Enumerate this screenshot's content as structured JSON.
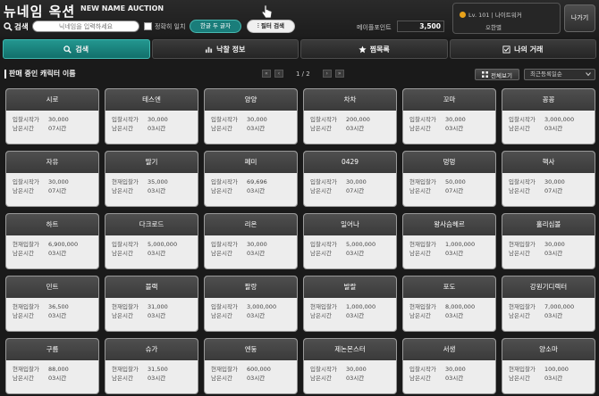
{
  "header": {
    "title": "뉴네임 옥션",
    "subtitle": "NEW NAME AUCTION",
    "search_label": "검색",
    "search_placeholder": "닉네임을 입력하세요",
    "exact_match_label": "정확히 일치",
    "search_mode_button": "한글 두 글자",
    "filter_button": "필터 검색",
    "points_label": "메이플포인트",
    "points_value": "3,500",
    "profile_level": "Lv. 101 | 나이트워커",
    "profile_name": "오한별",
    "exit_button": "나가기"
  },
  "tabs": [
    {
      "label": "검색",
      "icon": "search-icon",
      "active": true
    },
    {
      "label": "낙찰 정보",
      "icon": "bar-chart-icon",
      "active": false
    },
    {
      "label": "찜목록",
      "icon": "star-icon",
      "active": false
    },
    {
      "label": "나의 거래",
      "icon": "checkbox-icon",
      "active": false
    }
  ],
  "list": {
    "title": "판매 중인 캐릭터 이름",
    "page_text": "1 / 2",
    "view_all": "전체보기",
    "sort_selected": "최근등록일순"
  },
  "cards": [
    {
      "name": "시로",
      "price_label": "입찰시작가",
      "price": "30,000",
      "time_label": "남은시간",
      "time": "07시간"
    },
    {
      "name": "테스엔",
      "price_label": "입찰시작가",
      "price": "30,000",
      "time_label": "남은시간",
      "time": "03시간"
    },
    {
      "name": "양양",
      "price_label": "입찰시작가",
      "price": "30,000",
      "time_label": "남은시간",
      "time": "03시간"
    },
    {
      "name": "차차",
      "price_label": "입찰시작가",
      "price": "200,000",
      "time_label": "남은시간",
      "time": "03시간"
    },
    {
      "name": "꼬마",
      "price_label": "입찰시작가",
      "price": "30,000",
      "time_label": "남은시간",
      "time": "03시간"
    },
    {
      "name": "꽁꽁",
      "price_label": "입찰시작가",
      "price": "3,000,000",
      "time_label": "남은시간",
      "time": "03시간"
    },
    {
      "name": "자유",
      "price_label": "입찰시작가",
      "price": "30,000",
      "time_label": "남은시간",
      "time": "07시간"
    },
    {
      "name": "딸기",
      "price_label": "현재입찰가",
      "price": "35,000",
      "time_label": "남은시간",
      "time": "03시간"
    },
    {
      "name": "페미",
      "price_label": "입찰시작가",
      "price": "69,696",
      "time_label": "남은시간",
      "time": "03시간"
    },
    {
      "name": "0429",
      "price_label": "입찰시작가",
      "price": "30,000",
      "time_label": "남은시간",
      "time": "07시간"
    },
    {
      "name": "멍멍",
      "price_label": "현재입찰가",
      "price": "50,000",
      "time_label": "남은시간",
      "time": "07시간"
    },
    {
      "name": "핵사",
      "price_label": "입찰시작가",
      "price": "30,000",
      "time_label": "남은시간",
      "time": "07시간"
    },
    {
      "name": "하트",
      "price_label": "현재입찰가",
      "price": "6,900,000",
      "time_label": "남은시간",
      "time": "03시간"
    },
    {
      "name": "다크로드",
      "price_label": "입찰시작가",
      "price": "5,000,000",
      "time_label": "남은시간",
      "time": "03시간"
    },
    {
      "name": "리온",
      "price_label": "입찰시작가",
      "price": "30,000",
      "time_label": "남은시간",
      "time": "03시간"
    },
    {
      "name": "일어나",
      "price_label": "입찰시작가",
      "price": "5,000,000",
      "time_label": "남은시간",
      "time": "03시간"
    },
    {
      "name": "왕사슴헤르",
      "price_label": "현재입찰가",
      "price": "1,000,000",
      "time_label": "남은시간",
      "time": "03시간"
    },
    {
      "name": "홀리심볼",
      "price_label": "현재입찰가",
      "price": "30,000",
      "time_label": "남은시간",
      "time": "03시간"
    },
    {
      "name": "민트",
      "price_label": "현재입찰가",
      "price": "36,500",
      "time_label": "남은시간",
      "time": "03시간"
    },
    {
      "name": "블랙",
      "price_label": "현재입찰가",
      "price": "31,000",
      "time_label": "남은시간",
      "time": "03시간"
    },
    {
      "name": "팔랑",
      "price_label": "입찰시작가",
      "price": "3,000,000",
      "time_label": "남은시간",
      "time": "03시간"
    },
    {
      "name": "발랄",
      "price_label": "현재입찰가",
      "price": "1,000,000",
      "time_label": "남은시간",
      "time": "03시간"
    },
    {
      "name": "포도",
      "price_label": "현재입찰가",
      "price": "8,000,000",
      "time_label": "남은시간",
      "time": "03시간"
    },
    {
      "name": "강원기디렉터",
      "price_label": "현재입찰가",
      "price": "7,000,000",
      "time_label": "남은시간",
      "time": "03시간"
    },
    {
      "name": "구름",
      "price_label": "현재입찰가",
      "price": "88,000",
      "time_label": "남은시간",
      "time": "03시간"
    },
    {
      "name": "슈가",
      "price_label": "현재입찰가",
      "price": "31,500",
      "time_label": "남은시간",
      "time": "03시간"
    },
    {
      "name": "엔둥",
      "price_label": "현재입찰가",
      "price": "600,000",
      "time_label": "남은시간",
      "time": "03시간"
    },
    {
      "name": "제논몬스터",
      "price_label": "입찰시작가",
      "price": "30,000",
      "time_label": "남은시간",
      "time": "03시간"
    },
    {
      "name": "서생",
      "price_label": "입찰시작가",
      "price": "30,000",
      "time_label": "남은시간",
      "time": "03시간"
    },
    {
      "name": "양소마",
      "price_label": "현재입찰가",
      "price": "100,000",
      "time_label": "남은시간",
      "time": "03시간"
    }
  ]
}
